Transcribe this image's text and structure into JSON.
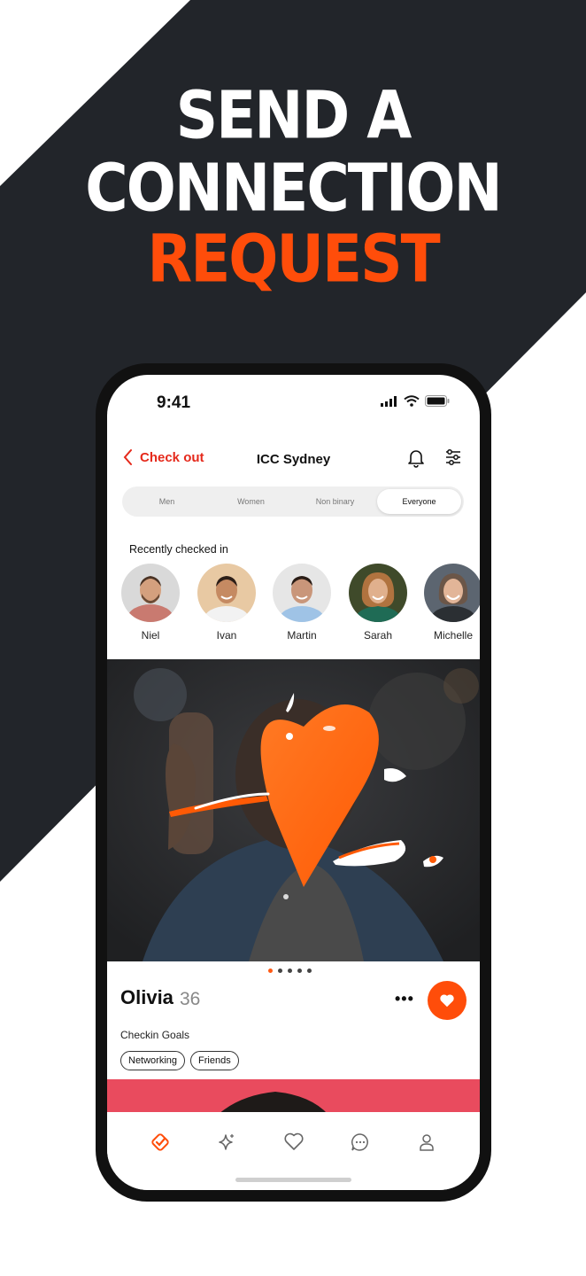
{
  "headline": {
    "line1": "SEND A",
    "line2": "CONNECTION",
    "line3": "REQUEST"
  },
  "colors": {
    "dark": "#22252a",
    "accent": "#ff4d0a",
    "back_red": "#e5291b"
  },
  "status": {
    "time": "9:41"
  },
  "header": {
    "back_label": "Check out",
    "title": "ICC Sydney",
    "icons": [
      "bell-icon",
      "sliders-icon"
    ]
  },
  "segments": {
    "items": [
      "Men",
      "Women",
      "Non binary",
      "Everyone"
    ],
    "selected": "Everyone"
  },
  "recent": {
    "title": "Recently checked in",
    "people": [
      {
        "name": "Niel"
      },
      {
        "name": "Ivan"
      },
      {
        "name": "Martin"
      },
      {
        "name": "Sarah"
      },
      {
        "name": "Michelle"
      }
    ]
  },
  "profile": {
    "name": "Olivia",
    "age": "36",
    "photo_count": 5,
    "photo_index": 1,
    "goals_label": "Checkin Goals",
    "tags": [
      "Networking",
      "Friends"
    ]
  },
  "tabbar": {
    "items": [
      "checkin-icon",
      "sparkle-icon",
      "heart-icon",
      "chat-icon",
      "profile-icon"
    ],
    "active": "checkin-icon"
  }
}
